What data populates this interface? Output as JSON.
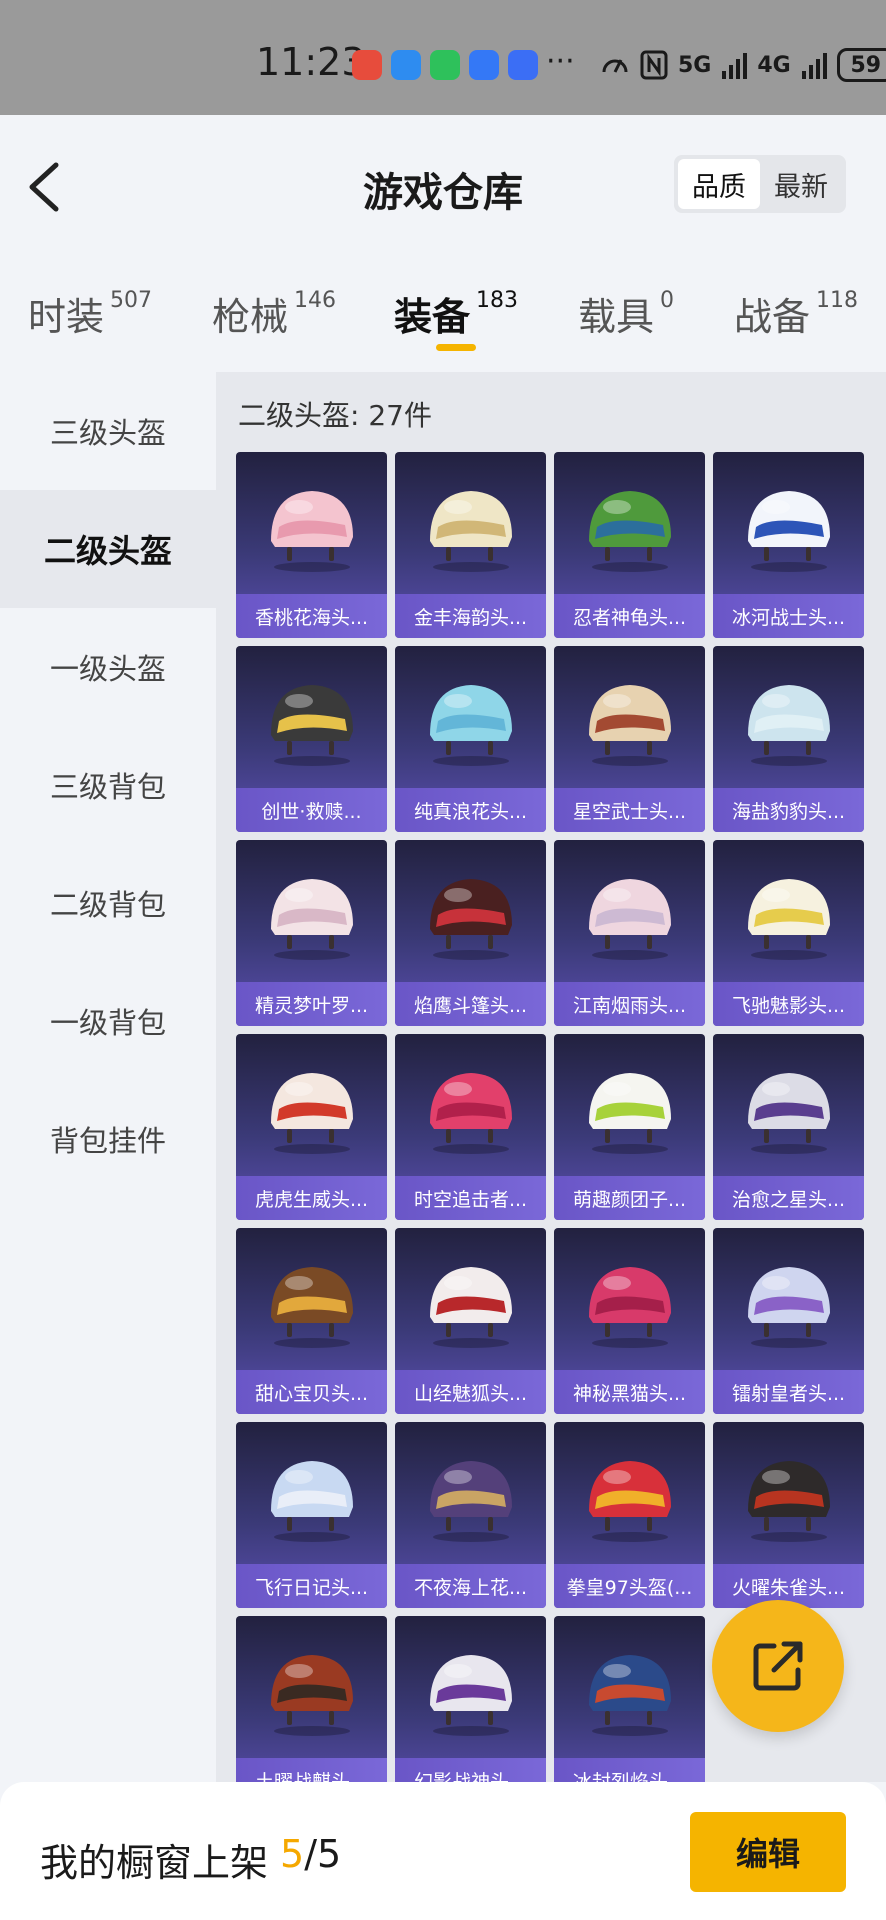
{
  "status_bar": {
    "time": "11:23",
    "battery": "59",
    "apps": [
      {
        "icon": "missed-call-icon",
        "color": "#e74c3c"
      },
      {
        "icon": "messages-icon",
        "color": "#2e8cf0"
      },
      {
        "icon": "wechat-icon",
        "color": "#2ec15b"
      },
      {
        "icon": "browser-icon",
        "color": "#3478f6"
      },
      {
        "icon": "game-center-icon",
        "color": "#3b6ef5"
      }
    ],
    "more": "···",
    "network_5g": "5G",
    "network_4g": "4G"
  },
  "header": {
    "title": "游戏仓库",
    "sort_options": [
      "品质",
      "最新"
    ],
    "sort_active": 0
  },
  "tabs": [
    {
      "label": "时装",
      "count": "507"
    },
    {
      "label": "枪械",
      "count": "146"
    },
    {
      "label": "装备",
      "count": "183"
    },
    {
      "label": "载具",
      "count": "0"
    },
    {
      "label": "战备",
      "count": "118"
    }
  ],
  "active_tab": 2,
  "sidebar": {
    "items": [
      "三级头盔",
      "二级头盔",
      "一级头盔",
      "三级背包",
      "二级背包",
      "一级背包",
      "背包挂件"
    ],
    "active": 1
  },
  "content": {
    "section_title": "二级头盔: 27件",
    "items": [
      {
        "name": "香桃花海头...",
        "c1": "#f4c4cf",
        "c2": "#e89aae"
      },
      {
        "name": "金丰海韵头...",
        "c1": "#efe6c6",
        "c2": "#d1b777"
      },
      {
        "name": "忍者神龟头...",
        "c1": "#4f9a3c",
        "c2": "#2c6f9c"
      },
      {
        "name": "冰河战士头...",
        "c1": "#f2f5fb",
        "c2": "#2d55b8"
      },
      {
        "name": "创世·救赎...",
        "c1": "#3a3a3a",
        "c2": "#e6c14a"
      },
      {
        "name": "纯真浪花头...",
        "c1": "#8fd6e8",
        "c2": "#63b6d8"
      },
      {
        "name": "星空武士头...",
        "c1": "#e7d2b0",
        "c2": "#a34a32"
      },
      {
        "name": "海盐豹豹头...",
        "c1": "#cde4ee",
        "c2": "#e0f0f5"
      },
      {
        "name": "精灵梦叶罗...",
        "c1": "#f3e3e6",
        "c2": "#d9b8c7"
      },
      {
        "name": "焰鹰斗篷头...",
        "c1": "#4a2020",
        "c2": "#c7323a"
      },
      {
        "name": "江南烟雨头...",
        "c1": "#efd6df",
        "c2": "#cdbad3"
      },
      {
        "name": "飞驰魅影头...",
        "c1": "#f6f1df",
        "c2": "#e6cc4c"
      },
      {
        "name": "虎虎生威头...",
        "c1": "#f4e7df",
        "c2": "#d23a2a"
      },
      {
        "name": "时空追击者...",
        "c1": "#e2406b",
        "c2": "#b1204b"
      },
      {
        "name": "萌趣颜团子...",
        "c1": "#f5f5f0",
        "c2": "#a7d23a"
      },
      {
        "name": "治愈之星头...",
        "c1": "#dcdce6",
        "c2": "#5a3e8f"
      },
      {
        "name": "甜心宝贝头...",
        "c1": "#7a4a25",
        "c2": "#e2a83c"
      },
      {
        "name": "山经魅狐头...",
        "c1": "#f2ecec",
        "c2": "#b8282b"
      },
      {
        "name": "神秘黑猫头...",
        "c1": "#d83a6a",
        "c2": "#a51f4a"
      },
      {
        "name": "镭射皇者头...",
        "c1": "#cfd5ef",
        "c2": "#8a62c7"
      },
      {
        "name": "飞行日记头...",
        "c1": "#c8d9f2",
        "c2": "#e9eef8"
      },
      {
        "name": "不夜海上花...",
        "c1": "#54407a",
        "c2": "#c9a464"
      },
      {
        "name": "拳皇97头盔(...",
        "c1": "#d8303a",
        "c2": "#f0b02a"
      },
      {
        "name": "火曜朱雀头...",
        "c1": "#2e2a2a",
        "c2": "#b83420"
      },
      {
        "name": "土曜战麒头...",
        "c1": "#9a3a22",
        "c2": "#3a2a22"
      },
      {
        "name": "幻影战神头...",
        "c1": "#e8e6ee",
        "c2": "#6a3a9a"
      },
      {
        "name": "冰封烈焰头...",
        "c1": "#2b4a8a",
        "c2": "#c84a30"
      }
    ]
  },
  "bottom_bar": {
    "showcase_label": "我的橱窗上架",
    "showcase_current": "5",
    "showcase_total": "/5",
    "edit_label": "编辑"
  },
  "colors": {
    "accent": "#f5b400",
    "card_label_bg": "#7a68d8"
  }
}
